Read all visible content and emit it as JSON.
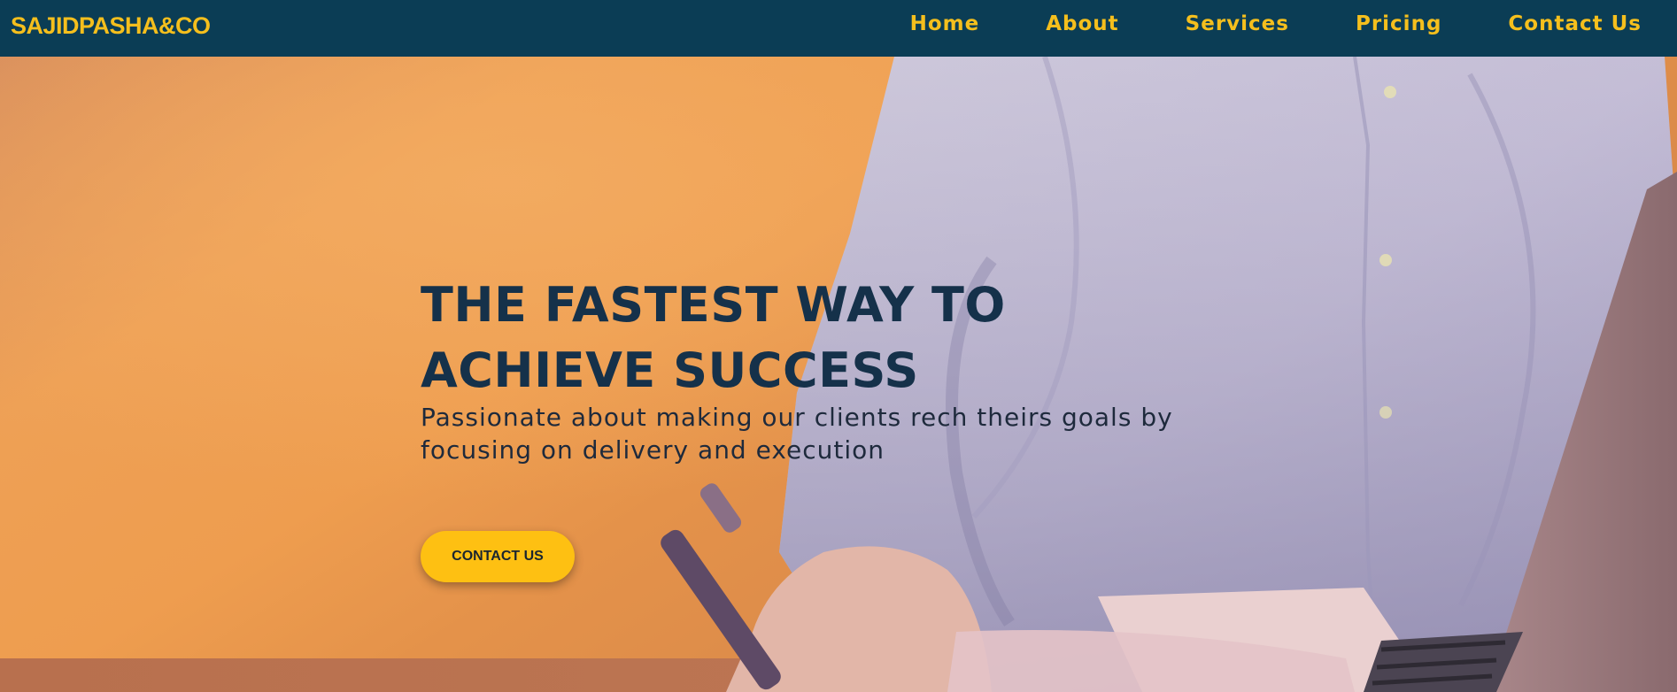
{
  "colors": {
    "navbar_bg": "#0b3d55",
    "nav_text": "#f5bf1d",
    "hero_orange": "#e89a4e",
    "title_text": "#15314a",
    "button_bg": "#fec012"
  },
  "navbar": {
    "brand": "SAJIDPASHA&CO",
    "links": [
      {
        "label": "Home"
      },
      {
        "label": "About"
      },
      {
        "label": "Services"
      },
      {
        "label": "Pricing"
      },
      {
        "label": "Contact Us"
      }
    ]
  },
  "hero": {
    "title": "THE FASTEST WAY TO ACHIEVE SUCCESS",
    "subtitle": "Passionate about making our clients rech theirs goals by focusing on delivery and execution",
    "cta_label": "CONTACT US",
    "background": "person-writing-with-pen-at-desk-photo"
  }
}
